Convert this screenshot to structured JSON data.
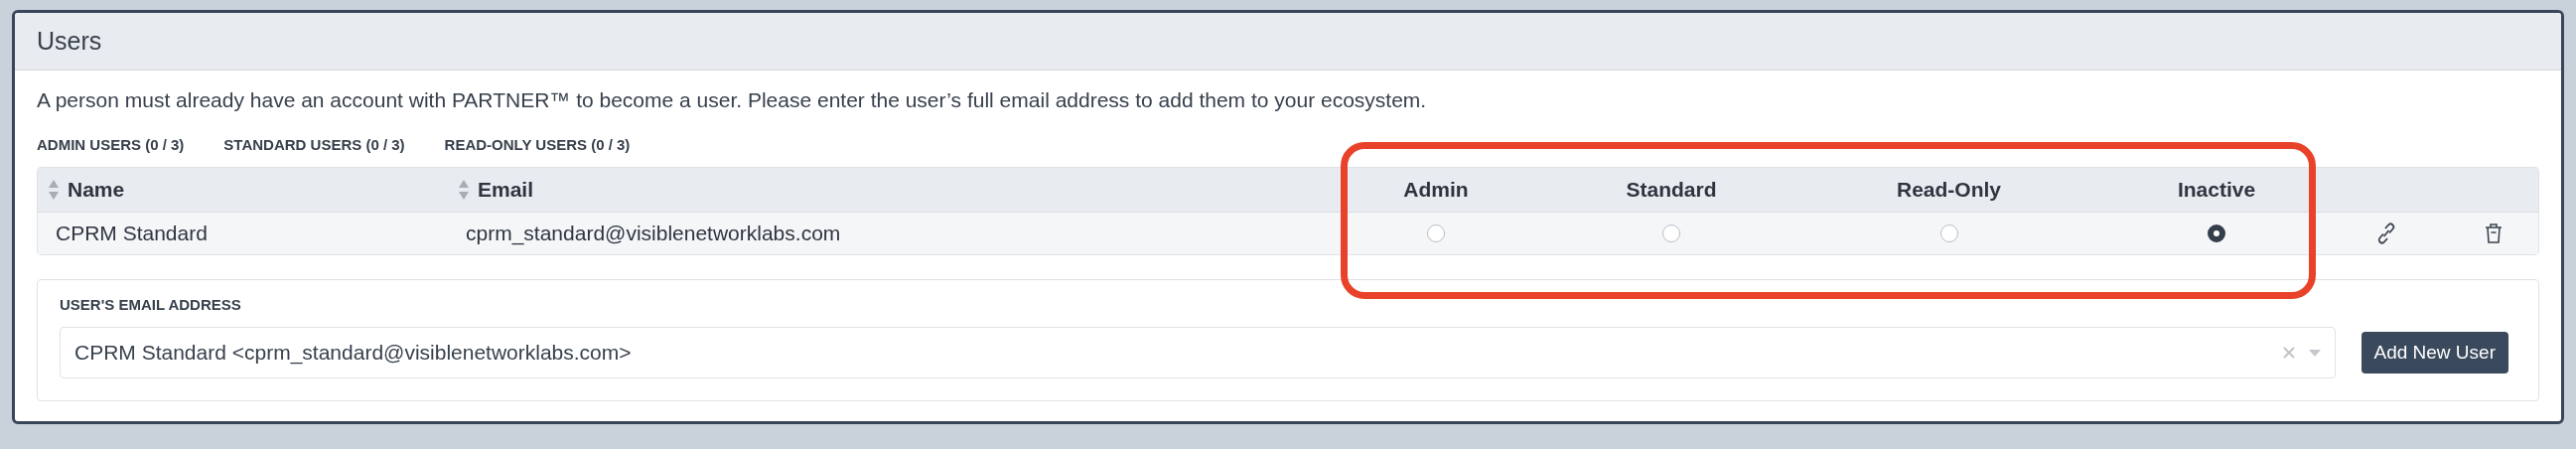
{
  "panel": {
    "title": "Users"
  },
  "description": "A person must already have an account with PARTNER™ to become a user. Please enter the user’s full email address to add them to your ecosystem.",
  "user_counts": [
    "ADMIN USERS (0 / 3)",
    "STANDARD USERS (0 / 3)",
    "READ-ONLY USERS (0 / 3)"
  ],
  "table": {
    "columns": [
      {
        "label": "Name",
        "kind": "sortable"
      },
      {
        "label": "Email",
        "kind": "sortable"
      },
      {
        "label": "Admin",
        "kind": "role"
      },
      {
        "label": "Standard",
        "kind": "role"
      },
      {
        "label": "Read-Only",
        "kind": "role"
      },
      {
        "label": "Inactive",
        "kind": "role"
      }
    ],
    "rows": [
      {
        "name": "CPRM Standard",
        "email": "cprm_standard@visiblenetworklabs.com",
        "roles": [
          {
            "selected": false
          },
          {
            "selected": false
          },
          {
            "selected": false
          },
          {
            "selected": true
          }
        ]
      }
    ]
  },
  "annotation": {
    "kind": "highlight-box"
  },
  "add_user": {
    "label": "USER'S EMAIL ADDRESS",
    "value": "CPRM Standard <cprm_standard@visiblenetworklabs.com>",
    "button": "Add New User"
  }
}
